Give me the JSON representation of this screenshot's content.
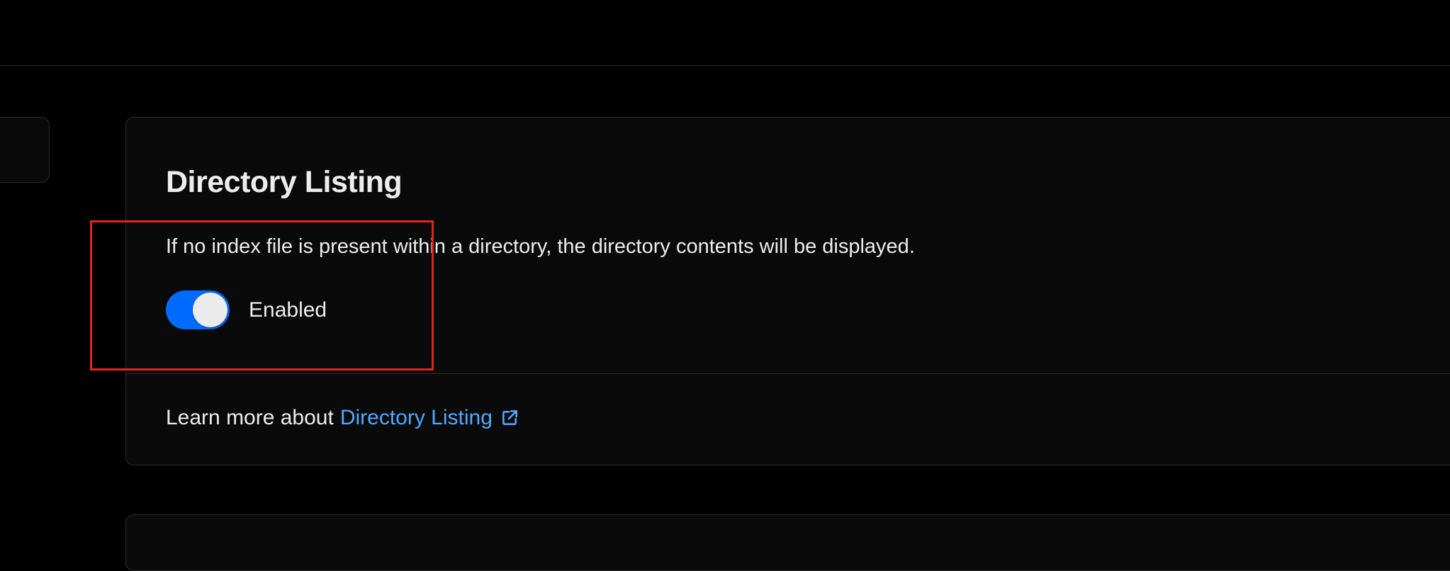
{
  "section": {
    "title": "Directory Listing",
    "description": "If no index file is present within a directory, the directory contents will be displayed.",
    "toggle": {
      "label": "Enabled",
      "state": "on",
      "color": "#006bff"
    },
    "footer": {
      "prefix": "Learn more about",
      "link_text": "Directory Listing",
      "link_icon": "external-link-icon",
      "link_color": "#52a8ff"
    }
  },
  "highlight": {
    "color": "#e3241b"
  }
}
